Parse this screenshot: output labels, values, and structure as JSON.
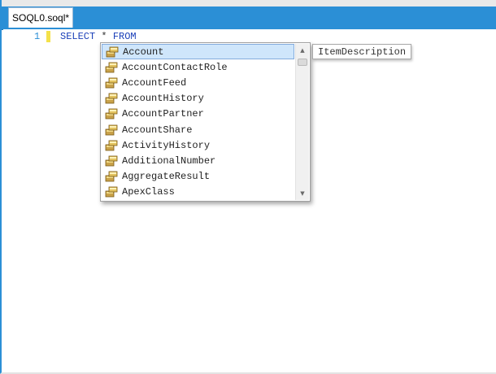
{
  "tab": {
    "title": "SOQL0.soql*"
  },
  "editor": {
    "line_number": "1",
    "code": {
      "keyword1": "SELECT",
      "star": "*",
      "keyword2": "FROM"
    }
  },
  "autocomplete": {
    "icon": "class-icon",
    "selected_index": 0,
    "items": [
      {
        "label": "Account"
      },
      {
        "label": "AccountContactRole"
      },
      {
        "label": "AccountFeed"
      },
      {
        "label": "AccountHistory"
      },
      {
        "label": "AccountPartner"
      },
      {
        "label": "AccountShare"
      },
      {
        "label": "ActivityHistory"
      },
      {
        "label": "AdditionalNumber"
      },
      {
        "label": "AggregateResult"
      },
      {
        "label": "ApexClass"
      }
    ],
    "scroll_up_glyph": "▲",
    "scroll_down_glyph": "▼"
  },
  "description_tooltip": {
    "text": "ItemDescription"
  },
  "colors": {
    "tab_strip": "#2b8fd6",
    "keyword": "#1a3fb8",
    "line_number": "#2b8fd6",
    "change_marker": "#f4e14a",
    "selection": "#cfe6fb"
  }
}
